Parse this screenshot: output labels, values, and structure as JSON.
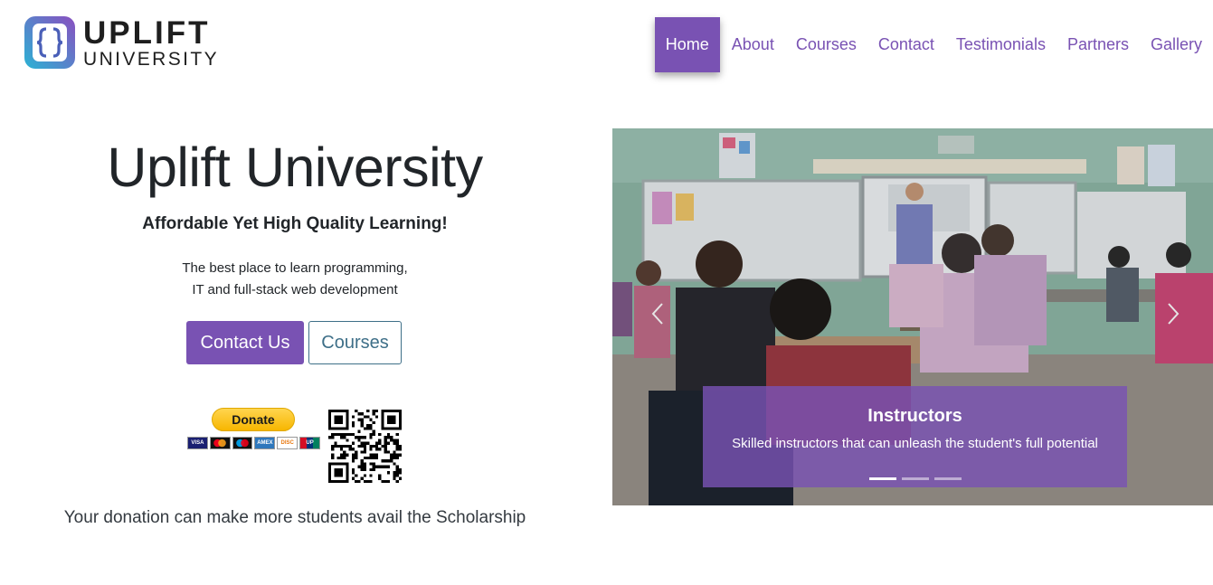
{
  "brand": {
    "name_line1": "UPLIFT",
    "name_line2": "UNIVERSITY"
  },
  "nav": {
    "items": [
      {
        "label": "Home",
        "active": true
      },
      {
        "label": "About"
      },
      {
        "label": "Courses"
      },
      {
        "label": "Contact"
      },
      {
        "label": "Testimonials"
      },
      {
        "label": "Partners"
      },
      {
        "label": "Gallery"
      }
    ]
  },
  "hero": {
    "title": "Uplift University",
    "tagline": "Affordable Yet High Quality Learning!",
    "description_line1": "The best place to learn programming,",
    "description_line2": "IT and full-stack web development",
    "buttons": {
      "contact": "Contact Us",
      "courses": "Courses"
    }
  },
  "donate": {
    "button_label": "Donate",
    "cards": [
      "VISA",
      "MC",
      "MAE",
      "AMEX",
      "DISC",
      "UP"
    ],
    "note": "Your donation can make more students avail the Scholarship"
  },
  "carousel": {
    "slide_caption_title": "Instructors",
    "slide_caption_text": "Skilled instructors that can unleash the student's full potential",
    "slide_count": 3,
    "active_index": 0,
    "prev_icon": "chevron-left-icon",
    "next_icon": "chevron-right-icon"
  },
  "colors": {
    "accent": "#7952b3",
    "outline": "#3e6f88",
    "paypal": "#ffc439"
  }
}
